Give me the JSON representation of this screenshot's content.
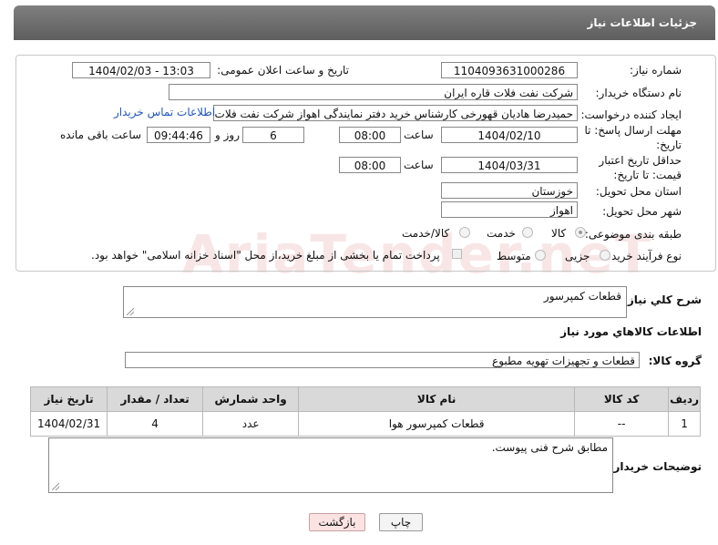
{
  "header": {
    "title": "جزئیات اطلاعات نیاز"
  },
  "watermark": "AriaTender.neT",
  "form": {
    "need_number_label": "شماره نیاز:",
    "need_number": "1104093631000286",
    "announce_label": "تاریخ و ساعت اعلان عمومی:",
    "announce_value": "1404/02/03 - 13:03",
    "buyer_org_label": "نام دستگاه خریدار:",
    "buyer_org": "شرکت نفت فلات قاره ایران",
    "creator_label": "ایجاد کننده درخواست:",
    "creator": "حمیدرضا هادیان قهورخی کارشناس خرید دفتر نمایندگی اهواز شرکت نفت فلات",
    "contact_link": "اطلاعات تماس خریدار",
    "reply_deadline_label": "مهلت ارسال پاسخ: تا تاریخ:",
    "reply_date": "1404/02/10",
    "time_label": "ساعت",
    "reply_time": "08:00",
    "days_value": "6",
    "days_label": "روز و",
    "remaining_time": "09:44:46",
    "remaining_label": "ساعت باقی مانده",
    "price_deadline_label": "حداقل تاریخ اعتبار قیمت: تا تاریخ:",
    "price_date": "1404/03/31",
    "price_time": "08:00",
    "province_label": "استان محل تحویل:",
    "province": "خوزستان",
    "city_label": "شهر محل تحویل:",
    "city": "اهواز",
    "category_label": "طبقه بندی موضوعی:",
    "category_options": [
      "کالا",
      "خدمت",
      "کالا/خدمت"
    ],
    "process_label": "نوع فرآیند خرید :",
    "process_options": [
      "جزیی",
      "متوسط"
    ],
    "payment_note": "پرداخت تمام یا بخشی از مبلغ خرید،از محل \"اسناد خزانه اسلامی\" خواهد بود."
  },
  "description": {
    "label": "شرح کلي نياز:",
    "value": "قطعات کمپرسور"
  },
  "goods_section_title": "اطلاعات کالاهاي مورد نياز",
  "goods_group": {
    "label": "گروه کالا:",
    "value": "قطعات و تجهیزات تهویه مطبوع"
  },
  "table": {
    "headers": [
      "ردیف",
      "کد کالا",
      "نام کالا",
      "واحد شمارش",
      "تعداد / مقدار",
      "تاریخ نیاز"
    ],
    "rows": [
      [
        "1",
        "--",
        "قطعات کمپرسور هوا",
        "عدد",
        "4",
        "1404/02/31"
      ]
    ]
  },
  "buyer_notes": {
    "label": "توضیحات خریدار:",
    "value": "مطابق شرح فنی پیوست."
  },
  "buttons": {
    "print": "چاپ",
    "back": "بازگشت"
  }
}
